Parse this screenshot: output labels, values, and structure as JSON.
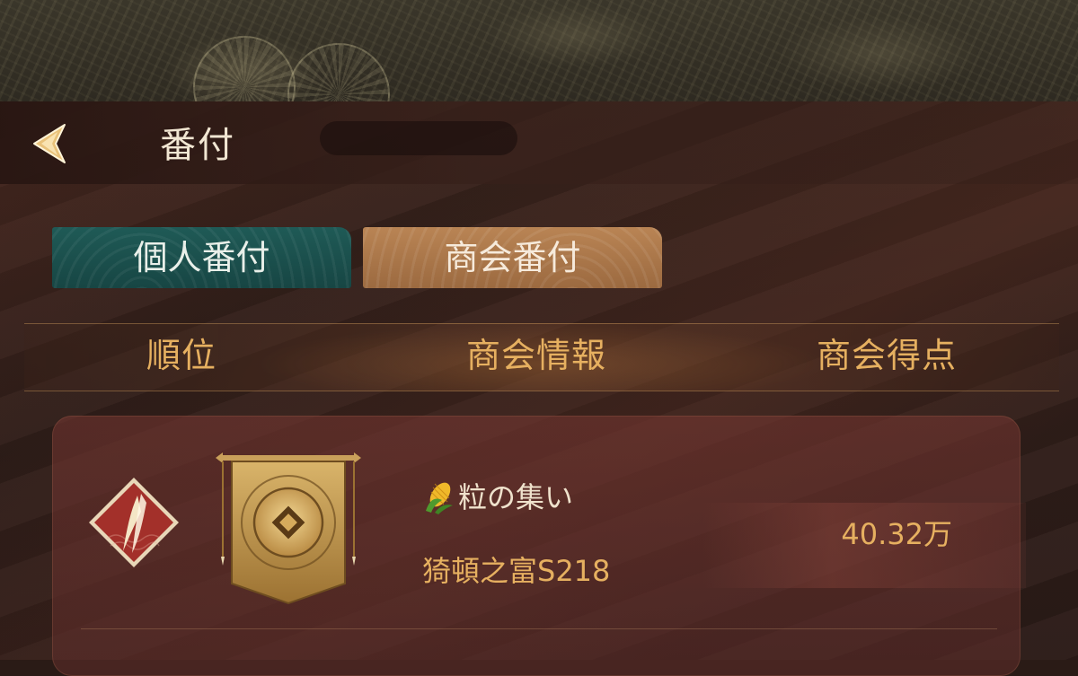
{
  "header": {
    "title": "番付",
    "back_icon": "chevron-left-icon"
  },
  "tabs": [
    {
      "label": "個人番付",
      "active": false,
      "color": "#1f5a56"
    },
    {
      "label": "商会番付",
      "active": true,
      "color": "#b98454"
    }
  ],
  "table": {
    "columns": [
      "順位",
      "商会情報",
      "商会得点"
    ],
    "rows": [
      {
        "rank_icon": "rank-one-diamond-icon",
        "guild_emblem_icon": "guild-banner-coin-icon",
        "guild_prefix_icon": "corn-icon",
        "guild_name": "粒の集い",
        "server": "猗頓之富S218",
        "score": "40.32万"
      }
    ]
  },
  "colors": {
    "accent_gold": "#e6b060",
    "text_light": "#efe2cc",
    "panel": "#33201b"
  }
}
